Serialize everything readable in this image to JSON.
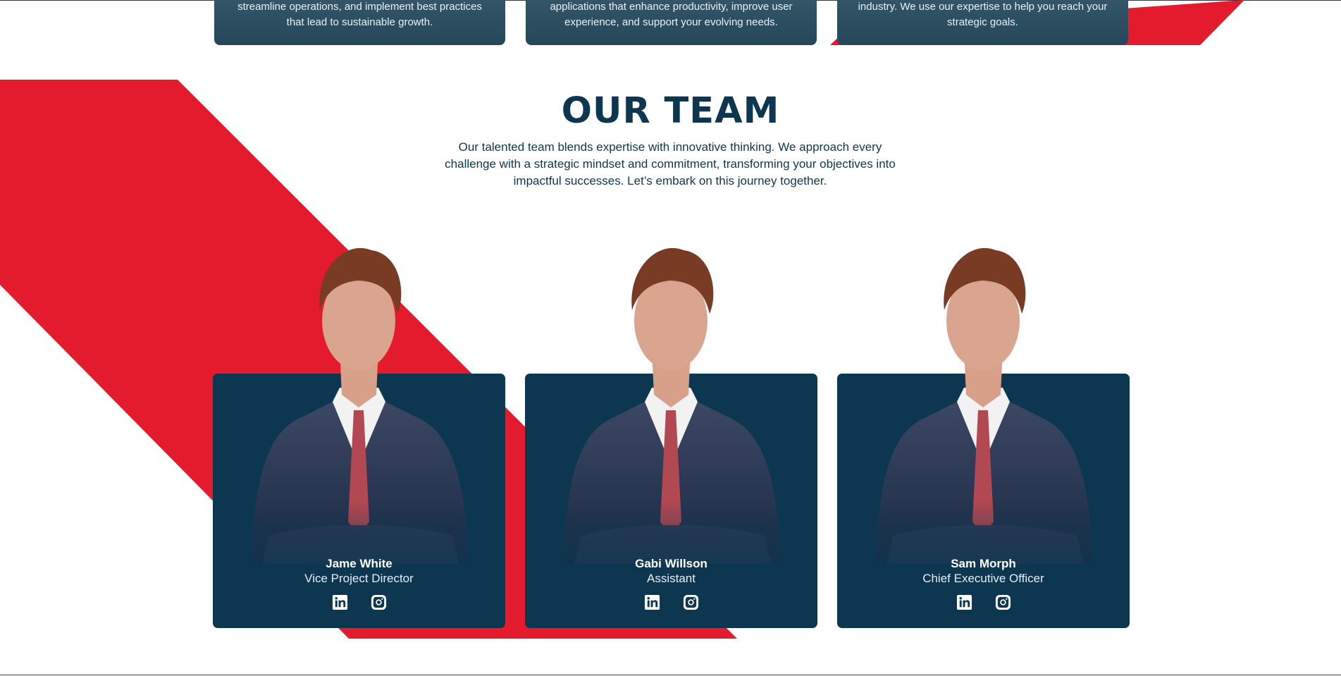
{
  "services": [
    {
      "line1": "streamline operations, and implement best practices",
      "line2": "that lead to sustainable growth."
    },
    {
      "line1": "applications that enhance productivity, improve user",
      "line2": "experience, and support your evolving needs."
    },
    {
      "line1": "industry. We use our expertise to help you reach your",
      "line2": "strategic goals."
    }
  ],
  "team": {
    "title": "OUR TEAM",
    "description": "Our talented team blends expertise with innovative thinking. We approach every challenge with a strategic mindset and commitment, transforming your objectives into impactful successes. Let’s embark on this journey together.",
    "members": [
      {
        "name": "Jame White",
        "role": "Vice Project Director"
      },
      {
        "name": "Gabi Willson",
        "role": "Assistant"
      },
      {
        "name": "Sam Morph",
        "role": "Chief Executive Officer"
      }
    ]
  },
  "icons": [
    "linkedin-icon",
    "instagram-icon"
  ],
  "colors": {
    "navy": "#0d3650",
    "red": "#e31b2d",
    "card_top": "#2d4f62",
    "white": "#ffffff"
  }
}
